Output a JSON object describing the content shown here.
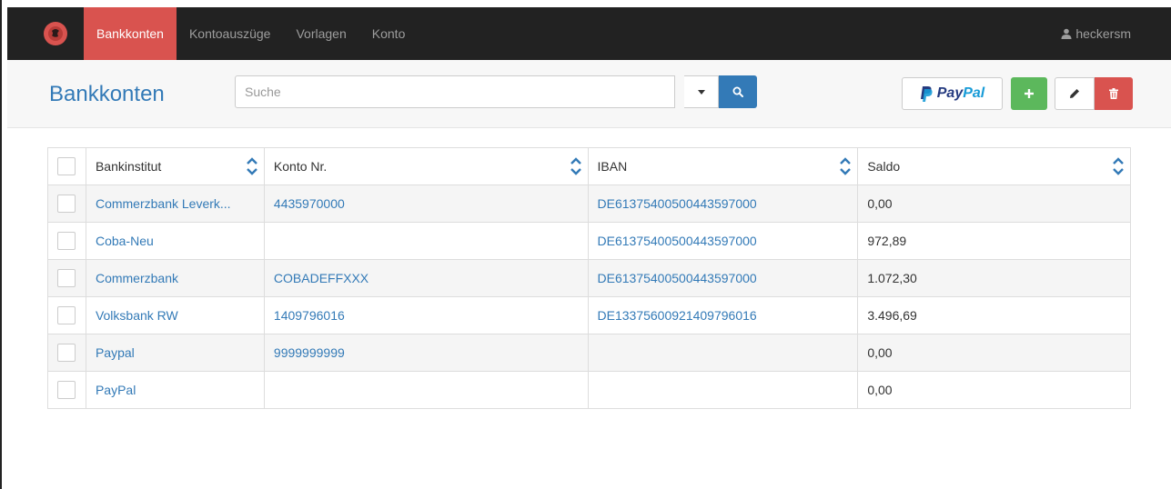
{
  "nav": {
    "items": [
      {
        "label": "Bankkonten",
        "active": true
      },
      {
        "label": "Kontoauszüge",
        "active": false
      },
      {
        "label": "Vorlagen",
        "active": false
      },
      {
        "label": "Konto",
        "active": false
      }
    ],
    "user": "heckersm",
    "user_icon": "user-icon",
    "logo_icon": "app-logo-icon"
  },
  "header": {
    "title": "Bankkonten",
    "search_placeholder": "Suche",
    "search_value": "",
    "paypal_label_dark": "Pay",
    "paypal_label_light": "Pal"
  },
  "colors": {
    "navbar": "#222222",
    "active_nav": "#d9534f",
    "primary": "#337ab7",
    "success": "#5cb85c",
    "danger": "#d9534f"
  },
  "table": {
    "headers": [
      "Bankinstitut",
      "Konto Nr.",
      "IBAN",
      "Saldo"
    ],
    "rows": [
      {
        "bank": "Commerzbank Leverk...",
        "konto": "4435970000",
        "iban": "DE61375400500443597000",
        "saldo": "0,00"
      },
      {
        "bank": "Coba-Neu",
        "konto": "",
        "iban": "DE61375400500443597000",
        "saldo": "972,89"
      },
      {
        "bank": "Commerzbank",
        "konto": "COBADEFFXXX",
        "iban": "DE61375400500443597000",
        "saldo": "1.072,30"
      },
      {
        "bank": "Volksbank RW",
        "konto": "1409796016",
        "iban": "DE13375600921409796016",
        "saldo": "3.496,69"
      },
      {
        "bank": "Paypal",
        "konto": "9999999999",
        "iban": "",
        "saldo": "0,00"
      },
      {
        "bank": "PayPal",
        "konto": "",
        "iban": "",
        "saldo": "0,00"
      }
    ]
  }
}
